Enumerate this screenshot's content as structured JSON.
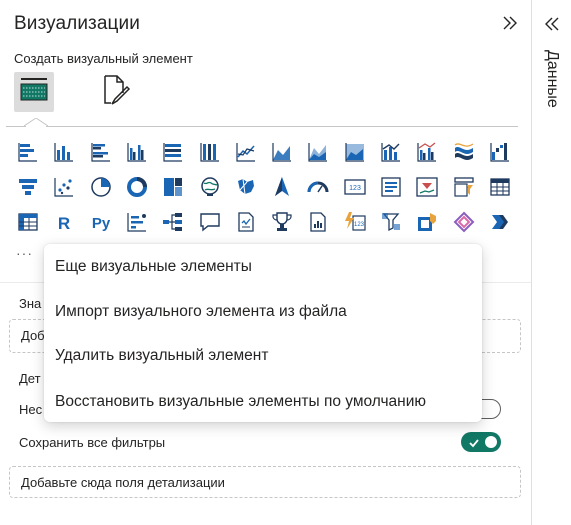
{
  "visualizations": {
    "title": "Визуализации",
    "subtitle": "Создать визуальный элемент",
    "collapse_icon": "chevron-double-right-icon",
    "tabs": [
      {
        "name": "build-visual",
        "icon": "build-visual-icon",
        "selected": true
      },
      {
        "name": "format-visual",
        "icon": "format-visual-icon",
        "selected": false
      }
    ],
    "visual_icons": [
      "stacked-bar-chart-icon",
      "stacked-column-chart-icon",
      "clustered-bar-chart-icon",
      "clustered-column-chart-icon",
      "100-percent-stacked-bar-chart-icon",
      "100-percent-stacked-column-chart-icon",
      "line-chart-icon",
      "area-chart-icon",
      "stacked-area-chart-icon",
      "100-percent-stacked-area-chart-icon",
      "line-and-stacked-column-chart-icon",
      "line-and-clustered-column-chart-icon",
      "ribbon-chart-icon",
      "waterfall-chart-icon",
      "funnel-chart-icon",
      "scatter-chart-icon",
      "pie-chart-icon",
      "donut-chart-icon",
      "treemap-icon",
      "map-icon",
      "filled-map-icon",
      "azure-map-icon",
      "gauge-icon",
      "card-icon",
      "multi-row-card-icon",
      "kpi-icon",
      "slicer-icon",
      "table-icon",
      "matrix-icon",
      "r-script-visual-icon",
      "python-visual-icon",
      "key-influencers-icon",
      "decomposition-tree-icon",
      "qna-icon",
      "smart-narrative-icon",
      "goals-icon",
      "paginated-report-icon",
      "power-apps-icon",
      "power-automate-icon",
      "arcgis-map-icon",
      "new-card-icon",
      "custom-visual-icon"
    ],
    "more_label": "···",
    "values_label": "Зна",
    "values_drop": "Доб",
    "drillthrough_label": "Дет",
    "cross_report_label": "Нес",
    "cross_report_on": false,
    "keep_filters_label": "Сохранить все фильтры",
    "keep_filters_on": true,
    "drillthrough_drop": "Добавьте сюда поля детализации"
  },
  "context_menu": {
    "items": [
      "Еще визуальные элементы",
      "Импорт визуального элемента из файла",
      "Удалить визуальный элемент",
      "Восстановить визуальные элементы по умолчанию"
    ]
  },
  "data_pane": {
    "label": "Данные",
    "collapse_icon": "chevron-double-left-icon"
  },
  "colors": {
    "accent": "#117865",
    "icon_blue": "#1a66b5",
    "icon_navy": "#1f3a5f",
    "icon_orange": "#e8a33c"
  }
}
